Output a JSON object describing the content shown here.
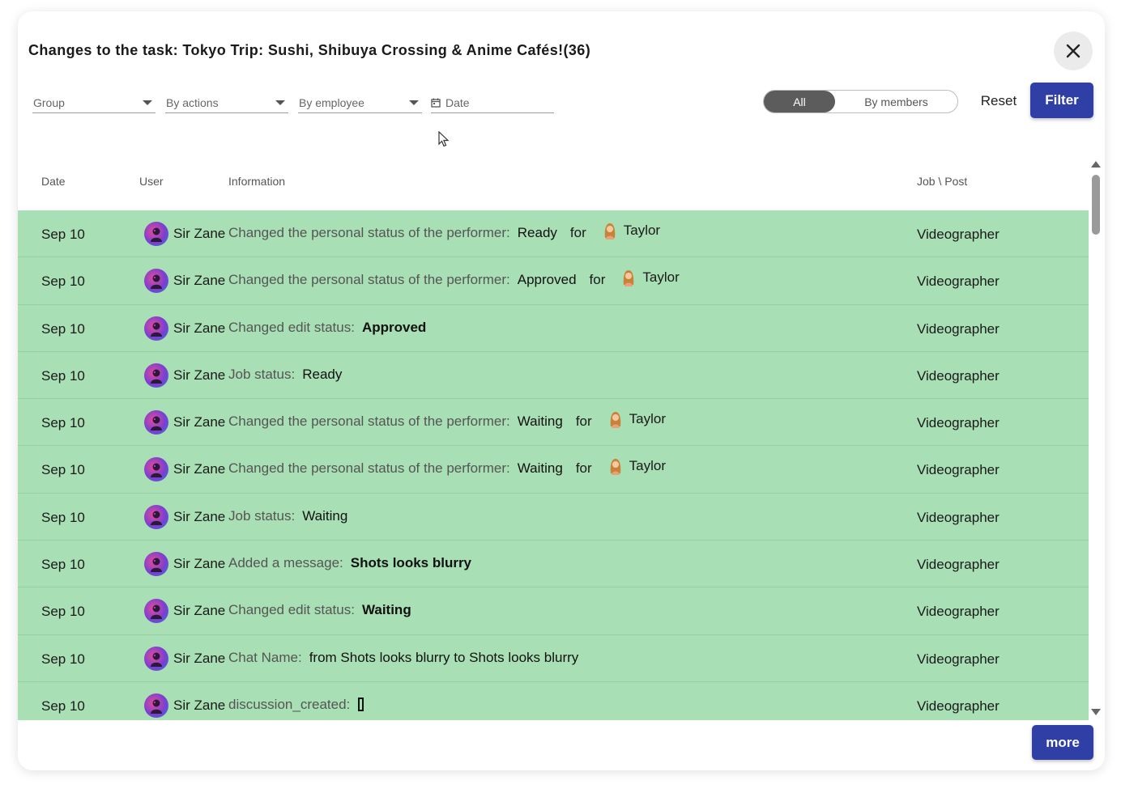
{
  "dialog": {
    "title": "Changes to the task: Tokyo Trip: Sushi, Shibuya Crossing & Anime Cafés!(36)",
    "close_icon": "close-icon"
  },
  "filters": {
    "group": "Group",
    "by_actions": "By actions",
    "by_employee": "By employee",
    "date": "Date",
    "toggle_all": "All",
    "toggle_members": "By members",
    "reset": "Reset",
    "filter": "Filter"
  },
  "table": {
    "headers": {
      "date": "Date",
      "user": "User",
      "information": "Information",
      "job": "Job \\ Post"
    },
    "rows": [
      {
        "date": "Sep 10",
        "user": "Sir Zane",
        "desc": "Changed the personal status of the performer:",
        "value": "Ready",
        "for": "for",
        "target": "Taylor",
        "job": "Videographer"
      },
      {
        "date": "Sep 10",
        "user": "Sir Zane",
        "desc": "Changed the personal status of the performer:",
        "value": "Approved",
        "for": "for",
        "target": "Taylor",
        "job": "Videographer"
      },
      {
        "date": "Sep 10",
        "user": "Sir Zane",
        "desc": "Changed edit status:",
        "value": "Approved",
        "bold": true,
        "job": "Videographer"
      },
      {
        "date": "Sep 10",
        "user": "Sir Zane",
        "desc": "Job status:",
        "value": "Ready",
        "job": "Videographer"
      },
      {
        "date": "Sep 10",
        "user": "Sir Zane",
        "desc": "Changed the personal status of the performer:",
        "value": "Waiting",
        "for": "for",
        "target": "Taylor",
        "job": "Videographer"
      },
      {
        "date": "Sep 10",
        "user": "Sir Zane",
        "desc": "Changed the personal status of the performer:",
        "value": "Waiting",
        "for": "for",
        "target": "Taylor",
        "job": "Videographer"
      },
      {
        "date": "Sep 10",
        "user": "Sir Zane",
        "desc": "Job status:",
        "value": "Waiting",
        "job": "Videographer"
      },
      {
        "date": "Sep 10",
        "user": "Sir Zane",
        "desc": "Added a message:",
        "value": "Shots looks blurry",
        "bold": true,
        "job": "Videographer"
      },
      {
        "date": "Sep 10",
        "user": "Sir Zane",
        "desc": "Changed edit status:",
        "value": "Waiting",
        "bold": true,
        "job": "Videographer"
      },
      {
        "date": "Sep 10",
        "user": "Sir Zane",
        "desc": "Chat Name:",
        "value": "from Shots looks blurry to Shots looks blurry",
        "job": "Videographer"
      },
      {
        "date": "Sep 10",
        "user": "Sir Zane",
        "desc": "discussion_created:",
        "value": "",
        "bracket": true,
        "job": "Videographer"
      }
    ]
  },
  "more_label": "more",
  "colors": {
    "row_bg": "#a8dfb4",
    "primary": "#2f3fa6",
    "toggle_active": "#5c5c5c"
  }
}
